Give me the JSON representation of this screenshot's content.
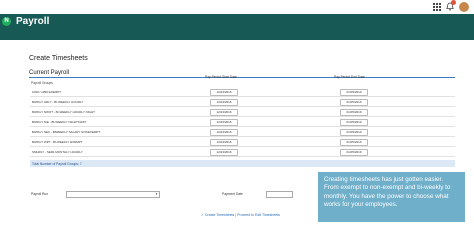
{
  "app": {
    "logo_glyph": "N",
    "title": "Payroll"
  },
  "topbar": {
    "apps_icon": "apps-grid-icon",
    "bell_icon": "bell-icon",
    "avatar": "user-avatar"
  },
  "page": {
    "title": "Create Timesheets"
  },
  "section": {
    "title": "Current Payroll",
    "group_header": "Payroll Groups",
    "start_header": "Pay Period Start Date",
    "end_header": "Pay Period End Date"
  },
  "rows": [
    {
      "name": "1099 / 1099 EXEMPT",
      "start": "12/23/2016",
      "end": "01/05/2019"
    },
    {
      "name": "BIWKLY HRLY - BI-WEEKLY HOURLY",
      "start": "12/23/2016",
      "end": "01/05/2019"
    },
    {
      "name": "BIWKLY NWOT - BI-WEEKLY HOURLY NIGHT",
      "start": "12/23/2016",
      "end": "01/05/2019"
    },
    {
      "name": "BIWKLY N/E - BI-WEEKLY NIGHTSHIFT",
      "start": "12/23/2016",
      "end": "01/05/2019"
    },
    {
      "name": "BIWKLY NEX - BIWEEKLY SALARY NONEXEMPT",
      "start": "12/23/2016",
      "end": "01/05/2019"
    },
    {
      "name": "BIWKLY WPT - BI-WEEKLY EXEMPT",
      "start": "12/23/2016",
      "end": "01/05/2019"
    },
    {
      "name": "SMHRLY - SEMI-MONTHLY HOURLY",
      "start": "12/23/2016",
      "end": "01/05/2019"
    }
  ],
  "total": {
    "label": "Total Number of Payroll Groups: 7"
  },
  "form": {
    "payroll_run_label": "Payroll Run",
    "payment_date_label": "Payment Date"
  },
  "actions": {
    "label": "✓ Create Timesheets  |  Proceed to Edit Timesheets"
  },
  "callout": {
    "text": "Creating timesheets has just gotten easier. From exempt to non-exempt and bi-weekly to monthly. You have the power to choose what works for your employees."
  },
  "colors": {
    "header": "#175a55",
    "accent": "#3a7bc8",
    "callout": "#6fafc9"
  }
}
